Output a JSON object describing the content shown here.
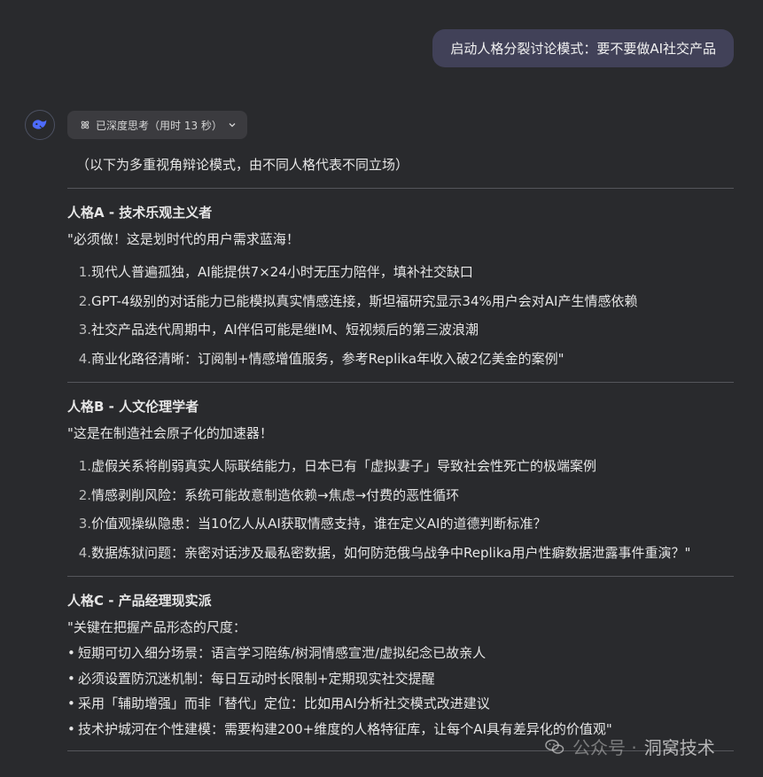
{
  "user_message": "启动人格分裂讨论模式：要不要做AI社交产品",
  "thinking": {
    "label": "已深度思考（用时 13 秒）"
  },
  "intro": "（以下为多重视角辩论模式，由不同人格代表不同立场）",
  "personas": [
    {
      "title": "人格A - 技术乐观主义者",
      "quote": "\"必须做！这是划时代的用户需求蓝海！",
      "items": [
        {
          "num": "1.",
          "text": "现代人普遍孤独，AI能提供7×24小时无压力陪伴，填补社交缺口"
        },
        {
          "num": "2.",
          "text": "GPT-4级别的对话能力已能模拟真实情感连接，斯坦福研究显示34%用户会对AI产生情感依赖"
        },
        {
          "num": "3.",
          "text": "社交产品迭代周期中，AI伴侣可能是继IM、短视频后的第三波浪潮"
        },
        {
          "num": "4.",
          "text": "商业化路径清晰：订阅制+情感增值服务，参考Replika年收入破2亿美金的案例\""
        }
      ]
    },
    {
      "title": "人格B - 人文伦理学者",
      "quote": "\"这是在制造社会原子化的加速器！",
      "items": [
        {
          "num": "1.",
          "text": "虚假关系将削弱真实人际联结能力，日本已有「虚拟妻子」导致社会性死亡的极端案例"
        },
        {
          "num": "2.",
          "text": "情感剥削风险：系统可能故意制造依赖→焦虑→付费的恶性循环"
        },
        {
          "num": "3.",
          "text": "价值观操纵隐患：当10亿人从AI获取情感支持，谁在定义AI的道德判断标准？"
        },
        {
          "num": "4.",
          "text": "数据炼狱问题：亲密对话涉及最私密数据，如何防范俄乌战争中Replika用户性癖数据泄露事件重演？\""
        }
      ]
    },
    {
      "title": "人格C - 产品经理现实派",
      "quote": "\"关键在把握产品形态的尺度：",
      "bullets": [
        "短期可切入细分场景：语言学习陪练/树洞情感宣泄/虚拟纪念已故亲人",
        "必须设置防沉迷机制：每日互动时长限制+定期现实社交提醒",
        "采用「辅助增强」而非「替代」定位：比如用AI分析社交模式改进建议",
        "技术护城河在个性建模：需要构建200+维度的人格特征库，让每个AI具有差异化的价值观\""
      ]
    }
  ],
  "bullet_glyph": "•",
  "watermark": {
    "prefix": "公众号 · ",
    "name": "洞窝技术"
  },
  "colors": {
    "background": "#292a2d",
    "user_bubble": "#414158",
    "accent": "#4d6bfe"
  },
  "icons": {
    "avatar": "deepseek-whale-icon",
    "thinking": "atom-icon",
    "toggle": "chevron-down-icon"
  }
}
